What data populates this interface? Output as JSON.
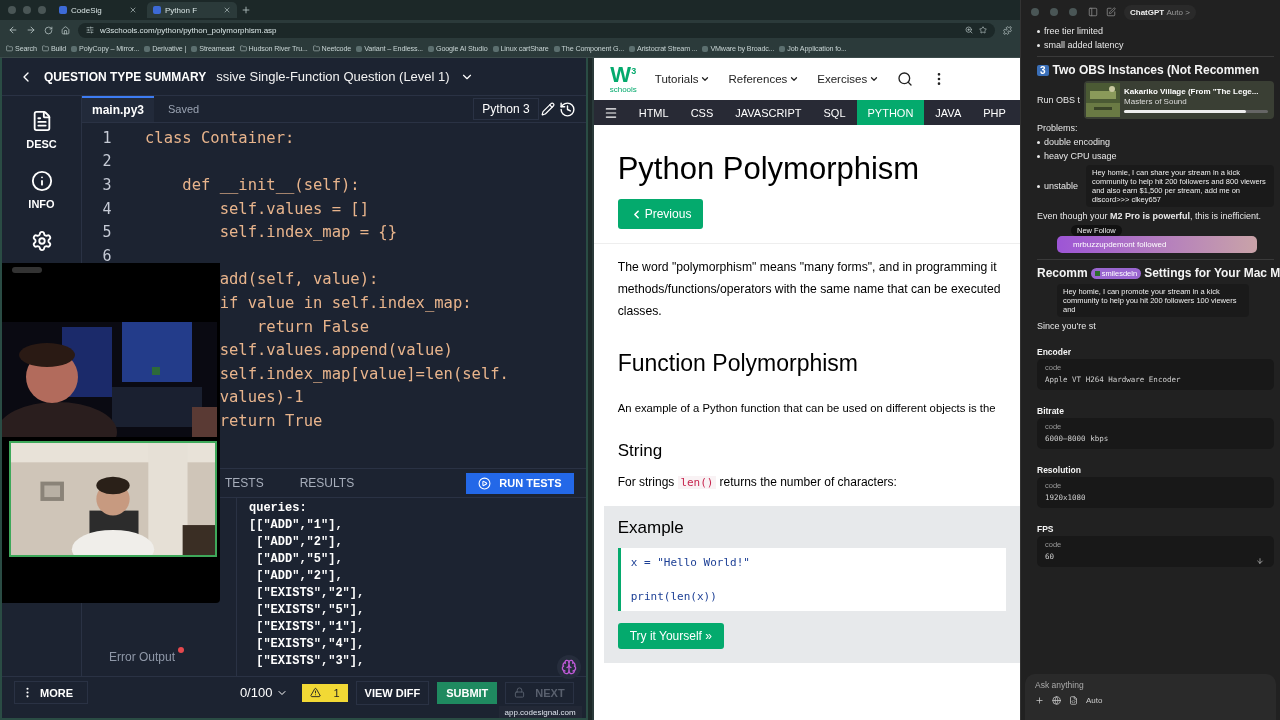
{
  "browser": {
    "tabs": [
      {
        "title": "CodeSig",
        "selected": false
      },
      {
        "title": "Python F",
        "selected": true
      }
    ],
    "url": "w3schools.com/python/python_polymorphism.asp",
    "bookmarks": [
      {
        "kind": "folder",
        "label": "Search"
      },
      {
        "kind": "folder",
        "label": "Build"
      },
      {
        "kind": "page",
        "label": "PolyCopy – Mirror..."
      },
      {
        "kind": "page",
        "label": "Derivative |"
      },
      {
        "kind": "page",
        "label": "Streameast"
      },
      {
        "kind": "folder",
        "label": "Hudson River Tru..."
      },
      {
        "kind": "folder",
        "label": "Neetcode"
      },
      {
        "kind": "page",
        "label": "Variant – Endless..."
      },
      {
        "kind": "page",
        "label": "Google AI Studio"
      },
      {
        "kind": "page",
        "label": "Linux cartShare"
      },
      {
        "kind": "page",
        "label": "The Component G..."
      },
      {
        "kind": "page",
        "label": "Aristocrat Stream ..."
      },
      {
        "kind": "page",
        "label": "VMware by Broadc..."
      },
      {
        "kind": "page",
        "label": "Job Application fo..."
      }
    ]
  },
  "codesignal": {
    "section": "QUESTION TYPE SUMMARY",
    "title": "ssive Single-Function Question (Level 1)",
    "sidebar": [
      {
        "kind": "document",
        "label": "DESC"
      },
      {
        "kind": "info",
        "label": "INFO"
      },
      {
        "kind": "gear"
      }
    ],
    "file_tab": {
      "label": "main.py3",
      "selected": true
    },
    "save_status": "Saved",
    "language": "Python 3",
    "code": [
      {
        "number": "1",
        "text": "class Container:"
      },
      {
        "number": "2"
      },
      {
        "number": "3",
        "text": "    def __init__(self):"
      },
      {
        "number": "4",
        "text": "        self.values = []"
      },
      {
        "number": "5",
        "text": "        self.index_map = {}"
      },
      {
        "number": "6"
      },
      {
        "text": "        add(self, value):"
      },
      {
        "text": "        if value in self.index_map:"
      },
      {
        "text": "            return False"
      },
      {
        "text": "        self.values.append(value)"
      },
      {
        "text": "        self.index_map[value]=len(self."
      },
      {
        "text": "        values)-1"
      },
      {
        "text": "        return True"
      }
    ],
    "test_tabs": [
      {
        "label": "TESTS",
        "selected": false
      },
      {
        "label": "RESULTS",
        "selected": false
      }
    ],
    "run_tests": "RUN TESTS",
    "test_nav": [
      {
        "label": "Error Output",
        "alert": true
      }
    ],
    "test_input": [
      "queries:",
      "[[\"ADD\",\"1\"],",
      " [\"ADD\",\"2\"],",
      " [\"ADD\",\"5\"],",
      " [\"ADD\",\"2\"],",
      " [\"EXISTS\",\"2\"],",
      " [\"EXISTS\",\"5\"],",
      " [\"EXISTS\",\"1\"],",
      " [\"EXISTS\",\"4\"],",
      " [\"EXISTS\",\"3\"],"
    ],
    "more": "MORE",
    "score": "0/100",
    "warnings": "1",
    "view_diff": "VIEW DIFF",
    "submit": "SUBMIT",
    "next": {
      "label": "NEXT",
      "disabled": true
    },
    "share_tooltip": "app.codesignal.com"
  },
  "webcams": [
    {
      "kind": "picture",
      "selected": false
    },
    {
      "kind": "picture",
      "selected": true
    }
  ],
  "w3schools": {
    "logo": {
      "mark": "W",
      "sup": "3",
      "word": "schools"
    },
    "menus": [
      "Tutorials",
      "References",
      "Exercises"
    ],
    "topnav": [
      {
        "label": "HTML",
        "selected": false
      },
      {
        "label": "CSS",
        "selected": false
      },
      {
        "label": "JAVASCRIPT",
        "selected": false
      },
      {
        "label": "SQL",
        "selected": false
      },
      {
        "label": "PYTHON",
        "selected": true
      },
      {
        "label": "JAVA",
        "selected": false
      },
      {
        "label": "PHP",
        "selected": false
      }
    ],
    "title": "Python Polymorphism",
    "previous": "Previous",
    "intro": [
      "The word \"polymorphism\" means \"many forms\", and in programming it",
      "methods/functions/operators with the same name that can be executed",
      "classes."
    ],
    "h2": "Function Polymorphism",
    "example_intro": "An example of a Python function that can be used on different objects is the",
    "h3": "String",
    "string_text": {
      "before": "For strings",
      "code": "len()",
      "after": "returns the number of characters:"
    },
    "example": {
      "title": "Example",
      "lines": [
        "x = \"Hello World!\"",
        "print(len(x))"
      ],
      "button": "Try it Yourself »"
    }
  },
  "chatgpt": {
    "title": "ChatGPT",
    "model": "Auto >",
    "blocks": [
      {
        "kind": "bullet",
        "text": "free tier limited"
      },
      {
        "kind": "bullet",
        "text": "small added latency"
      },
      {
        "kind": "divider"
      },
      {
        "kind": "heading",
        "badge": "3",
        "text": "Two OBS Instances (Not Recommen"
      },
      {
        "kind": "media_row",
        "text": "Run OBS t",
        "track": {
          "title": "Kakariko Village (From \"The Lege...",
          "artist": "Masters of Sound",
          "level": 0.85
        }
      },
      {
        "kind": "para",
        "text": "Problems:"
      },
      {
        "kind": "bullet",
        "text": "double encoding"
      },
      {
        "kind": "bullet",
        "text": "heavy CPU usage"
      },
      {
        "kind": "bullet",
        "text": "unstable",
        "notice": "Hey homie, I can share your stream in a kick community to help hit 200 followers and 800 viewers and also earn $1,500 per stream, add me on discord>>> clkey657"
      },
      {
        "kind": "para",
        "text": "Even though your **M2 Pro is powerful**, this is inefficient."
      },
      {
        "kind": "follow",
        "label": "New Follow",
        "text": "mrbuzzupdemont followed"
      },
      {
        "kind": "divider"
      },
      {
        "kind": "split_heading",
        "parts": [
          "Recomm",
          "Settings for Your Mac M"
        ],
        "chip": "smilesdeln"
      },
      {
        "kind": "notice",
        "text": "Hey homie, I can promote your stream in a kick community to help you hit 200 followers 100 viewers and"
      },
      {
        "kind": "para",
        "text": "Since you're st"
      },
      {
        "kind": "setting",
        "label": "Encoder",
        "code_label": "code",
        "value": "Apple VT H264 Hardware Encoder"
      },
      {
        "kind": "setting",
        "label": "Bitrate",
        "code_label": "code",
        "value": "6000–8000 kbps"
      },
      {
        "kind": "setting",
        "label": "Resolution",
        "code_label": "code",
        "value": "1920x1080"
      },
      {
        "kind": "setting",
        "label": "FPS",
        "code_label": "code",
        "value": "60"
      }
    ],
    "input": {
      "placeholder": "Ask anything"
    },
    "mode": "Auto"
  }
}
